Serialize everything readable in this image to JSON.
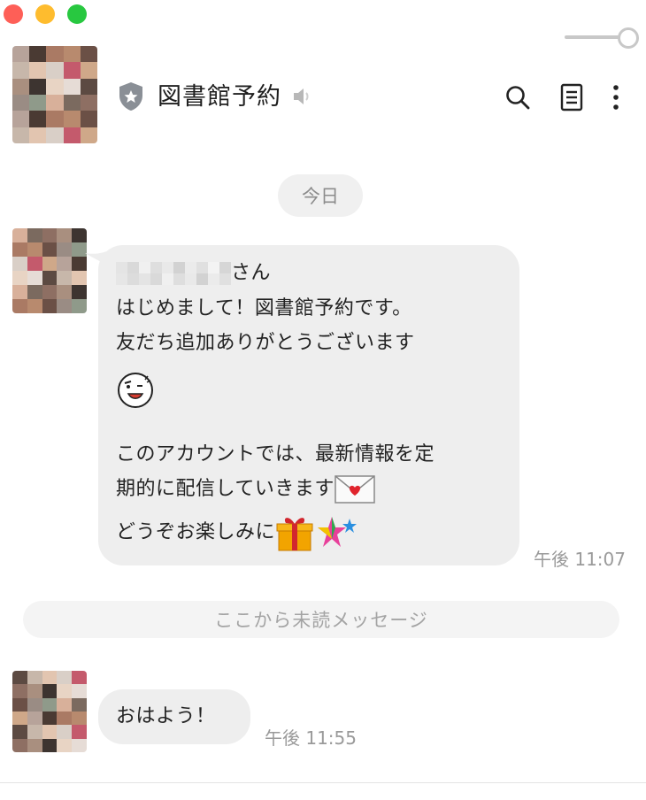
{
  "window": {
    "controls": [
      "close",
      "minimize",
      "zoom"
    ]
  },
  "header": {
    "title": "図書館予約",
    "icons": [
      "shield-star-icon",
      "speaker-muted-icon",
      "search-icon",
      "notes-icon",
      "more-vertical-icon"
    ]
  },
  "date_chip": "今日",
  "messages": [
    {
      "lines": {
        "l1_suffix": "さん",
        "l2": "はじめまして！図書館予約です。",
        "l3": "友だち追加ありがとうございます",
        "l4": "",
        "l5": "このアカウントでは、最新情報を定",
        "l6": "期的に配信していきます",
        "l7": "どうぞお楽しみに"
      },
      "emoji": [
        "wink-face-sticker-icon",
        "love-letter-icon",
        "gift-icon",
        "shooting-star-icon"
      ],
      "time": "午後 11:07"
    },
    {
      "text": "おはよう！",
      "time": "午後 11:55"
    }
  ],
  "unread_divider": "ここから未読メッセージ",
  "colors": {
    "bubble": "#eeeeee",
    "chip": "#f0f0f0",
    "muted_text": "#9a9a9a"
  }
}
